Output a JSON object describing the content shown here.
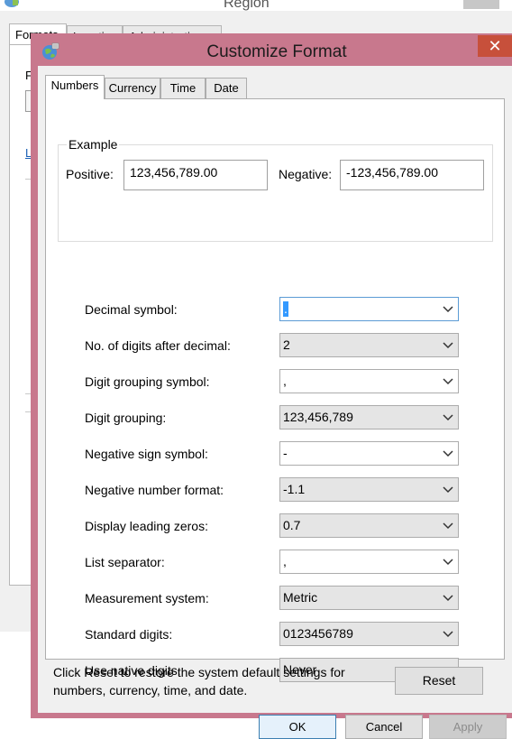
{
  "background_window": {
    "title": "Region",
    "tabs": [
      "Formats",
      "Location",
      "Administrative"
    ],
    "label_fragment": "F",
    "link_fragment": "L"
  },
  "dialog": {
    "title": "Customize Format",
    "close_glyph": "✕",
    "tabs": [
      "Numbers",
      "Currency",
      "Time",
      "Date"
    ],
    "active_tab": "Numbers",
    "example": {
      "legend": "Example",
      "positive_label": "Positive:",
      "positive_value": "123,456,789.00",
      "negative_label": "Negative:",
      "negative_value": "-123,456,789.00"
    },
    "settings": [
      {
        "label": "Decimal symbol:",
        "value": "."
      },
      {
        "label": "No. of digits after decimal:",
        "value": "2"
      },
      {
        "label": "Digit grouping symbol:",
        "value": ","
      },
      {
        "label": "Digit grouping:",
        "value": "123,456,789"
      },
      {
        "label": "Negative sign symbol:",
        "value": "-"
      },
      {
        "label": "Negative number format:",
        "value": "-1.1"
      },
      {
        "label": "Display leading zeros:",
        "value": "0.7"
      },
      {
        "label": "List separator:",
        "value": ","
      },
      {
        "label": "Measurement system:",
        "value": "Metric"
      },
      {
        "label": "Standard digits:",
        "value": "0123456789"
      },
      {
        "label": "Use native digits:",
        "value": "Never"
      }
    ],
    "reset_text": "Click Reset to restore the system default settings for numbers, currency, time, and date.",
    "buttons": {
      "reset": "Reset",
      "ok": "OK",
      "cancel": "Cancel",
      "apply": "Apply"
    }
  },
  "colors": {
    "titlebar_accent": "#c8788d",
    "close_button": "#c7503b",
    "selection": "#3399ff"
  }
}
